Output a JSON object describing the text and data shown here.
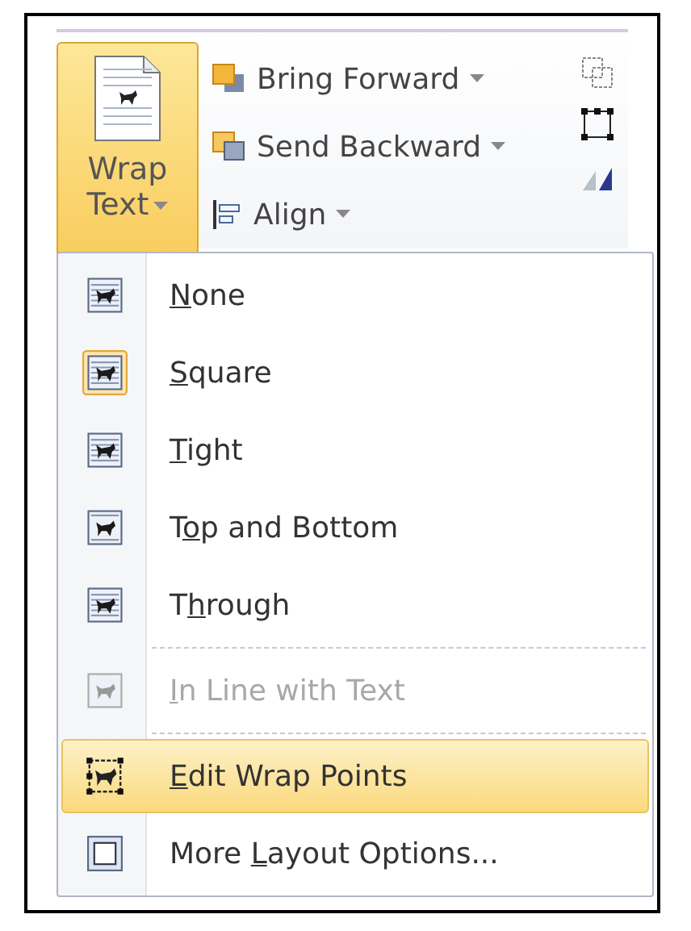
{
  "ribbon": {
    "wrap_button": {
      "line1": "Wrap",
      "line2": "Text",
      "open": true
    },
    "commands": [
      {
        "label": "Bring Forward",
        "kind": "forward"
      },
      {
        "label": "Send Backward",
        "kind": "backward"
      },
      {
        "label": "Align",
        "kind": "align"
      }
    ]
  },
  "menu": {
    "items": [
      {
        "key": "N",
        "rest": "one",
        "kind": "none",
        "selected": false,
        "highlighted": false,
        "disabled": false,
        "separator_before": false
      },
      {
        "key": "S",
        "rest": "quare",
        "kind": "square",
        "selected": true,
        "highlighted": false,
        "disabled": false,
        "separator_before": false
      },
      {
        "key": "T",
        "rest": "ight",
        "kind": "tight",
        "selected": false,
        "highlighted": false,
        "disabled": false,
        "separator_before": false
      },
      {
        "lead": "T",
        "key": "o",
        "rest": "p and Bottom",
        "kind": "topbottom",
        "selected": false,
        "highlighted": false,
        "disabled": false,
        "separator_before": false
      },
      {
        "lead": "T",
        "key": "h",
        "rest": "rough",
        "kind": "through",
        "selected": false,
        "highlighted": false,
        "disabled": false,
        "separator_before": false
      },
      {
        "key": "I",
        "rest": "n Line with Text",
        "kind": "inline",
        "selected": false,
        "highlighted": false,
        "disabled": true,
        "separator_before": true
      },
      {
        "key": "E",
        "rest": "dit Wrap Points",
        "kind": "points",
        "highlighted": true,
        "disabled": false,
        "separator_before": true
      },
      {
        "lead": "More ",
        "key": "L",
        "rest": "ayout Options...",
        "kind": "frame",
        "highlighted": false,
        "disabled": false,
        "separator_before": false
      }
    ]
  }
}
